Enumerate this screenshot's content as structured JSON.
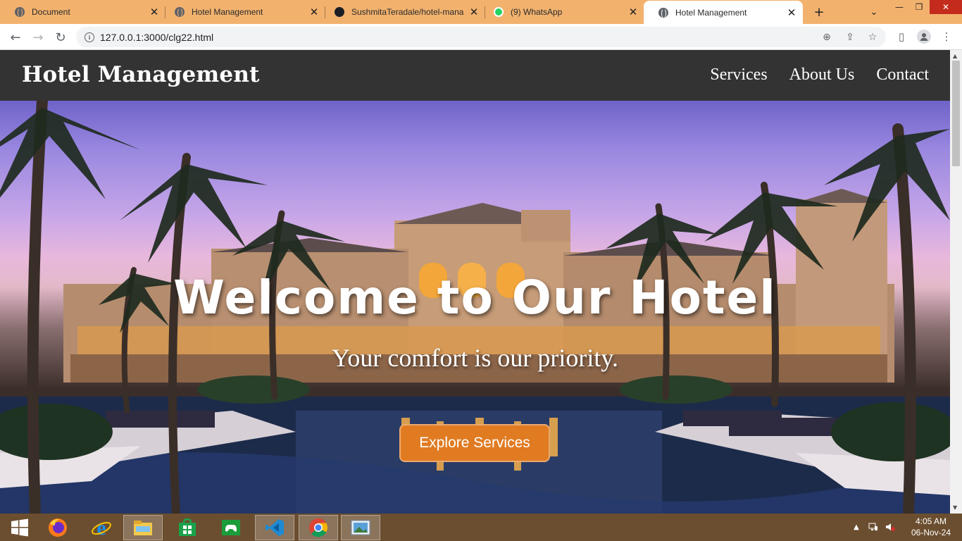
{
  "browser": {
    "tabs": [
      {
        "title": "Document",
        "icon": "globe-icon",
        "active": false
      },
      {
        "title": "Hotel Management",
        "icon": "globe-icon",
        "active": false
      },
      {
        "title": "SushmitaTeradale/hotel-mana",
        "icon": "github-icon",
        "active": false
      },
      {
        "title": "(9) WhatsApp",
        "icon": "whatsapp-icon",
        "active": false
      },
      {
        "title": "Hotel Management",
        "icon": "globe-icon",
        "active": true
      }
    ],
    "url": "127.0.0.1:3000/clg22.html"
  },
  "site": {
    "brand": "Hotel Management",
    "nav": [
      "Services",
      "About Us",
      "Contact"
    ]
  },
  "hero": {
    "title": "Welcome to Our Hotel",
    "subtitle": "Your comfort is our priority.",
    "cta": "Explore Services"
  },
  "taskbar": {
    "apps": [
      "windows-start",
      "firefox",
      "internet-explorer",
      "file-explorer",
      "store",
      "games",
      "vscode",
      "chrome",
      "photos"
    ],
    "time": "4:05 AM",
    "date": "06-Nov-24"
  },
  "colors": {
    "tabstrip": "#f2b26e",
    "header": "#333333",
    "cta": "#e07b22",
    "taskbar": "#6b4e2f"
  }
}
